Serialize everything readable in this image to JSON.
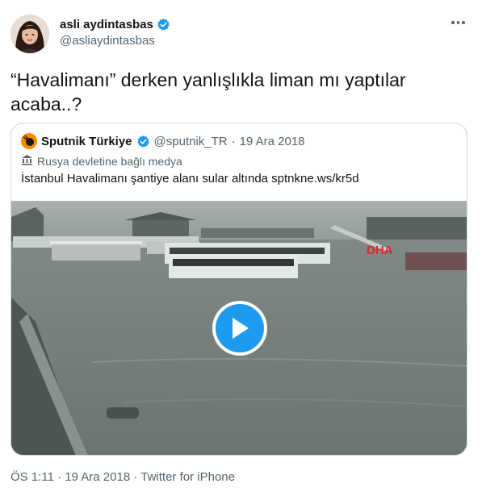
{
  "author": {
    "display_name": "asli aydintasbas",
    "handle": "@asliaydintasbas"
  },
  "tweet": {
    "text": "“Havalimanı” derken yanlışlıkla liman mı yaptılar acaba..?"
  },
  "quote": {
    "display_name": "Sputnik Türkiye",
    "handle": "@sputnik_TR",
    "separator": "·",
    "date": "19 Ara 2018",
    "label": "Rusya devletine bağlı medya",
    "text": "İstanbul Havalimanı şantiye alanı sular altında sptnkne.ws/kr5d",
    "media_watermark": "DHA"
  },
  "meta": {
    "time": "ÖS 1:11",
    "separator1": "·",
    "date": "19 Ara 2018",
    "separator2": "·",
    "source": "Twitter for iPhone"
  },
  "colors": {
    "verified": "#1d9bf0",
    "play": "#1d9bf0",
    "secondary_text": "#536471",
    "border": "#cfd9de"
  },
  "icons": {
    "verified": "verified-badge-icon",
    "more": "more-options-icon",
    "state_media": "state-media-building-icon",
    "play": "play-icon"
  }
}
